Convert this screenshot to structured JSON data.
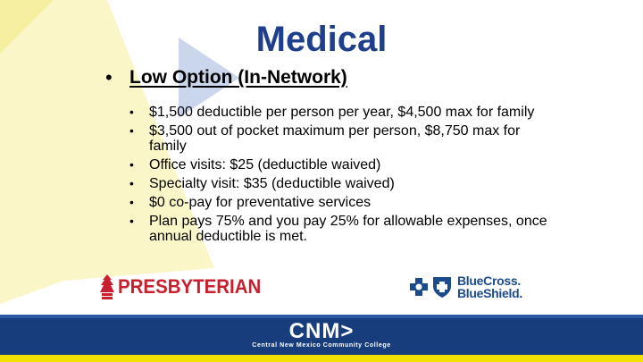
{
  "slide": {
    "title": "Medical",
    "heading": "Low Option (In-Network)",
    "bullets": [
      "$1,500 deductible per person per year, $4,500 max for family",
      "$3,500 out of pocket maximum per person, $8,750 max for family",
      "Office visits: $25 (deductible waived)",
      "Specialty visit: $35 (deductible waived)",
      "$0 co-pay for preventative services",
      "Plan pays 75% and you pay 25% for allowable expenses, once annual deductible is met."
    ]
  },
  "logos": {
    "presbyterian": "PRESBYTERIAN",
    "bcbs_line1": "BlueCross.",
    "bcbs_line2": "BlueShield."
  },
  "footer": {
    "brand": "CNM>",
    "subtitle": "Central New Mexico Community College"
  },
  "colors": {
    "title": "#1f3f8c",
    "footer": "#173d7c",
    "accent_yellow": "#f2e100",
    "presbyterian_red": "#c8202e",
    "bcbs_blue": "#1b4a8f"
  }
}
